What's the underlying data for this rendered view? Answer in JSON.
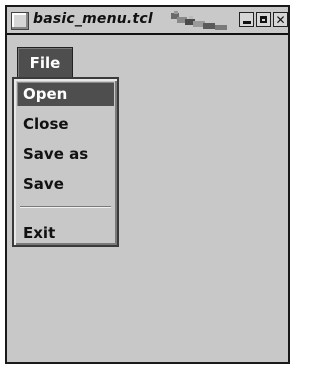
{
  "window": {
    "title": "basic_menu.tcl"
  },
  "titlebar": {
    "buttons": [
      "minimize",
      "maximize",
      "close"
    ],
    "close_label": "✕"
  },
  "menubar": {
    "file_label": "File"
  },
  "file_menu": {
    "items": [
      {
        "label": "Open",
        "active": true
      },
      {
        "label": "Close"
      },
      {
        "label": "Save as"
      },
      {
        "label": "Save"
      },
      {
        "label": "Exit"
      }
    ]
  },
  "colors": {
    "window_bg": "#c8c8c8",
    "active_bg": "#4e4e4e",
    "active_fg": "#ffffff"
  }
}
